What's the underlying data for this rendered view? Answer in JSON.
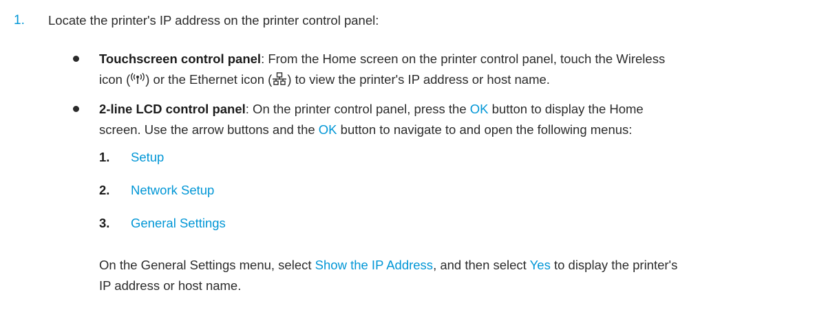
{
  "step": {
    "number": "1.",
    "text": "Locate the printer's IP address on the printer control panel:"
  },
  "touchscreen": {
    "label": "Touchscreen control panel",
    "text_a": ": From the Home screen on the printer control panel, touch the Wireless",
    "text_b1": "icon (",
    "text_b2": ") or the Ethernet icon (",
    "text_b3": ") to view the printer's IP address or host name.",
    "icons": [
      "wireless-icon",
      "ethernet-icon"
    ]
  },
  "lcd": {
    "label": "2-line LCD control panel",
    "text_a1": ": On the printer control panel, press the ",
    "ok": "OK",
    "text_a2": " button to display the Home",
    "text_b1": "screen. Use the arrow buttons and the ",
    "text_b2": " button to navigate to and open the following menus:",
    "menus": [
      {
        "num": "1.",
        "label": "Setup"
      },
      {
        "num": "2.",
        "label": "Network Setup"
      },
      {
        "num": "3.",
        "label": "General Settings"
      }
    ],
    "final_a1": "On the General Settings menu, select ",
    "show_ip": "Show the IP Address",
    "final_a2": ", and then select ",
    "yes": "Yes",
    "final_a3": " to display the printer's",
    "final_b": "IP address or host name."
  },
  "colors": {
    "accent": "#0096d6",
    "text": "#2b2b2b"
  }
}
